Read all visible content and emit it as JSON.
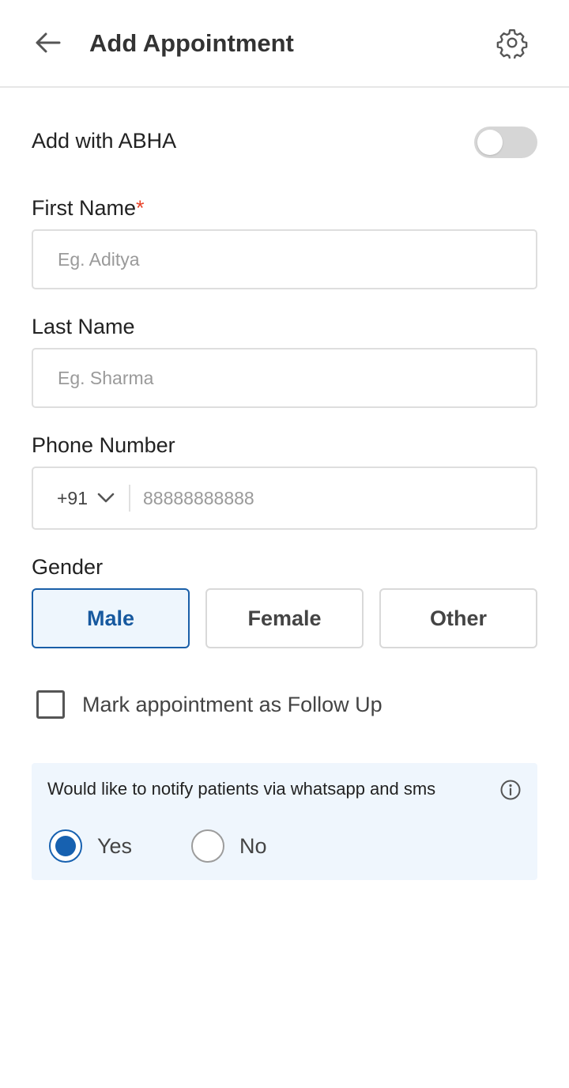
{
  "header": {
    "title": "Add Appointment",
    "back_icon": "arrow-left-icon",
    "settings_icon": "gear-icon"
  },
  "abha": {
    "label": "Add with ABHA",
    "enabled": false
  },
  "first_name": {
    "label": "First Name",
    "required_mark": "*",
    "placeholder": "Eg. Aditya",
    "value": ""
  },
  "last_name": {
    "label": "Last Name",
    "placeholder": "Eg. Sharma",
    "value": ""
  },
  "phone": {
    "label": "Phone Number",
    "country_code": "+91",
    "placeholder": "88888888888",
    "value": ""
  },
  "gender": {
    "label": "Gender",
    "options": [
      "Male",
      "Female",
      "Other"
    ],
    "selected": "Male"
  },
  "follow_up": {
    "label": "Mark appointment as Follow Up",
    "checked": false
  },
  "notify": {
    "text": "Would like to notify patients via whatsapp and sms",
    "info_icon": "info-icon",
    "options": [
      "Yes",
      "No"
    ],
    "selected": "Yes"
  },
  "colors": {
    "accent": "#1761b0",
    "selected_bg": "#eef6fd",
    "panel_bg": "#eff6fd",
    "required": "#e8442a",
    "toggle_off": "#d6d6d6"
  }
}
